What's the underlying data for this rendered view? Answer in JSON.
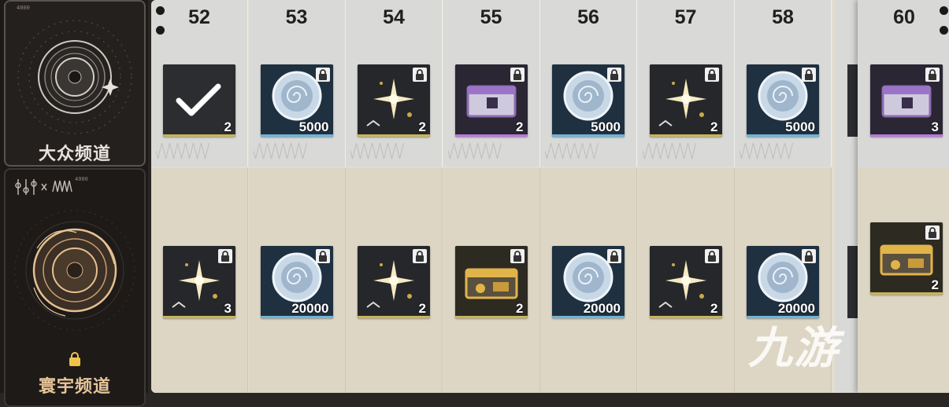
{
  "channels": [
    {
      "title": "大众频道",
      "locked": false,
      "header_code": "4000"
    },
    {
      "title": "寰宇频道",
      "locked": true,
      "header_code": "4000"
    }
  ],
  "levels": [
    {
      "level": "52",
      "top": {
        "kind": "check",
        "qty": "2",
        "bar": "#c9b45a",
        "locked": false
      },
      "bottom": {
        "kind": "sparkle",
        "qty": "3",
        "bar": "#c9b45a",
        "locked": true
      }
    },
    {
      "level": "53",
      "top": {
        "kind": "disc",
        "qty": "5000",
        "bar": "#6fb4d8",
        "locked": true
      },
      "bottom": {
        "kind": "disc",
        "qty": "20000",
        "bar": "#6fb4d8",
        "locked": true
      }
    },
    {
      "level": "54",
      "top": {
        "kind": "sparkle",
        "qty": "2",
        "bar": "#c9b45a",
        "locked": true
      },
      "bottom": {
        "kind": "sparkle",
        "qty": "2",
        "bar": "#c9b45a",
        "locked": true
      }
    },
    {
      "level": "55",
      "top": {
        "kind": "box-purple",
        "qty": "2",
        "bar": "#b77ad8",
        "locked": true
      },
      "bottom": {
        "kind": "box-gold",
        "qty": "2",
        "bar": "#c9b45a",
        "locked": true
      }
    },
    {
      "level": "56",
      "top": {
        "kind": "disc",
        "qty": "5000",
        "bar": "#6fb4d8",
        "locked": true
      },
      "bottom": {
        "kind": "disc",
        "qty": "20000",
        "bar": "#6fb4d8",
        "locked": true
      }
    },
    {
      "level": "57",
      "top": {
        "kind": "sparkle",
        "qty": "2",
        "bar": "#c9b45a",
        "locked": true
      },
      "bottom": {
        "kind": "sparkle",
        "qty": "2",
        "bar": "#c9b45a",
        "locked": true
      }
    },
    {
      "level": "58",
      "top": {
        "kind": "disc",
        "qty": "5000",
        "bar": "#6fb4d8",
        "locked": true
      },
      "bottom": {
        "kind": "disc",
        "qty": "20000",
        "bar": "#6fb4d8",
        "locked": true
      }
    }
  ],
  "featured": {
    "level": "60",
    "top": {
      "kind": "box-purple",
      "qty": "3",
      "bar": "#b77ad8",
      "locked": true
    },
    "bottom": {
      "kind": "box-gold",
      "qty": "2",
      "bar": "#c9b45a",
      "locked": true
    }
  },
  "watermark": "九游",
  "colors": {
    "board": "#e3ddcf",
    "gold": "#c9b45a",
    "blue": "#6fb4d8",
    "purple": "#b77ad8"
  }
}
